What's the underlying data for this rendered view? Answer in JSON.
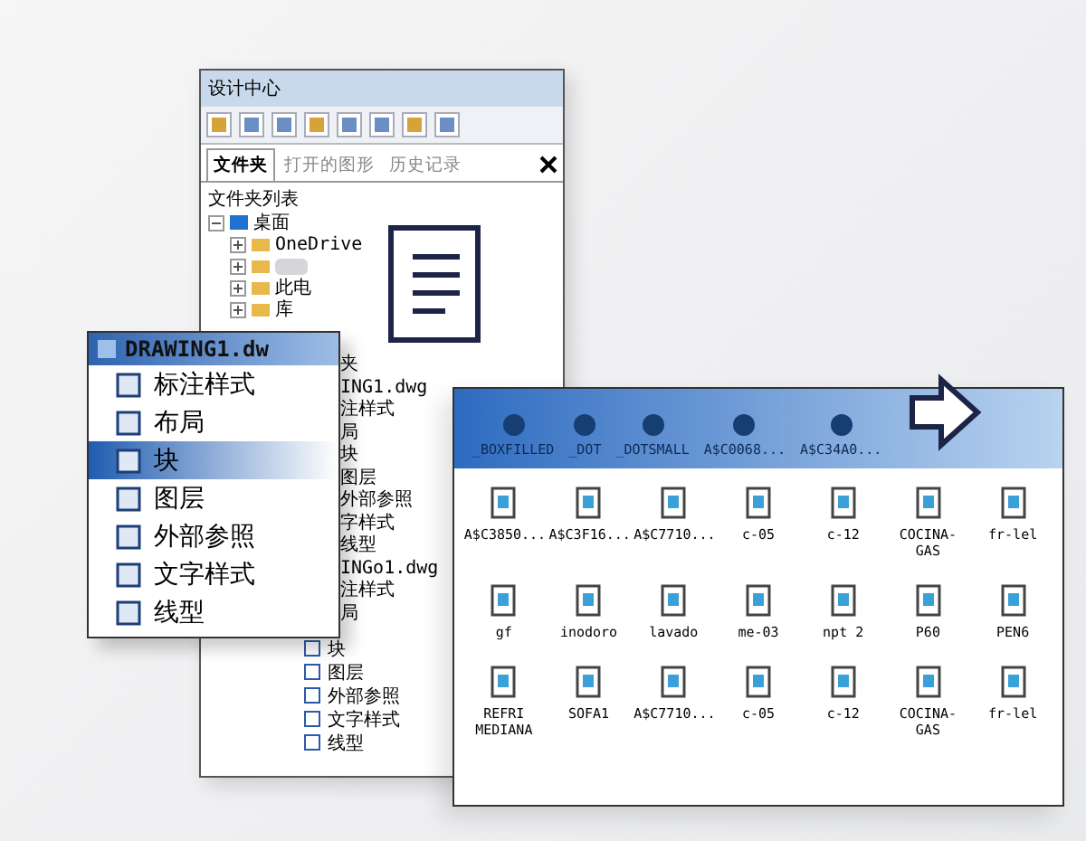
{
  "design_center": {
    "title": "设计中心",
    "tabs": [
      {
        "label": "文件夹",
        "selected": true
      },
      {
        "label": "打开的图形",
        "selected": false
      },
      {
        "label": "历史记录",
        "selected": false
      }
    ],
    "list_header": "文件夹列表",
    "tree": [
      {
        "label": "桌面",
        "expanded": true,
        "children": [
          {
            "label": "OneDrive"
          },
          {
            "kind": "blurred"
          },
          {
            "label": "此电"
          },
          {
            "label": "库"
          }
        ]
      }
    ],
    "listing": [
      "夹",
      "ING1.dwg",
      "注样式",
      "局",
      "块",
      "图层",
      "外部参照",
      "字样式",
      "线型",
      "INGo1.dwg",
      "注样式",
      "局"
    ],
    "listing_full": [
      "块",
      "图层",
      "外部参照",
      "文字样式",
      "线型"
    ]
  },
  "drawing_popup": {
    "title": "DRAWING1.dw",
    "items": [
      {
        "label": "标注样式",
        "selected": false
      },
      {
        "label": "布局",
        "selected": false
      },
      {
        "label": "块",
        "selected": true
      },
      {
        "label": "图层",
        "selected": false
      },
      {
        "label": "外部参照",
        "selected": false
      },
      {
        "label": "文字样式",
        "selected": false
      },
      {
        "label": "线型",
        "selected": false
      }
    ]
  },
  "block_palette": {
    "header_items": [
      "_BOXFILLED",
      "_DOT",
      "_DOTSMALL",
      "A$C0068...",
      "A$C34A0..."
    ],
    "rows": [
      [
        "A$C3850...",
        "A$C3F16...",
        "A$C7710...",
        "c-05",
        "c-12",
        "COCINA-GAS",
        "fr-lel"
      ],
      [
        "gf",
        "inodoro",
        "lavado",
        "me-03",
        "npt 2",
        "P60",
        "PEN6"
      ],
      [
        "REFRI MEDIANA",
        "SOFA1",
        "A$C7710...",
        "c-05",
        "c-12",
        "COCINA-GAS",
        "fr-lel"
      ]
    ]
  }
}
